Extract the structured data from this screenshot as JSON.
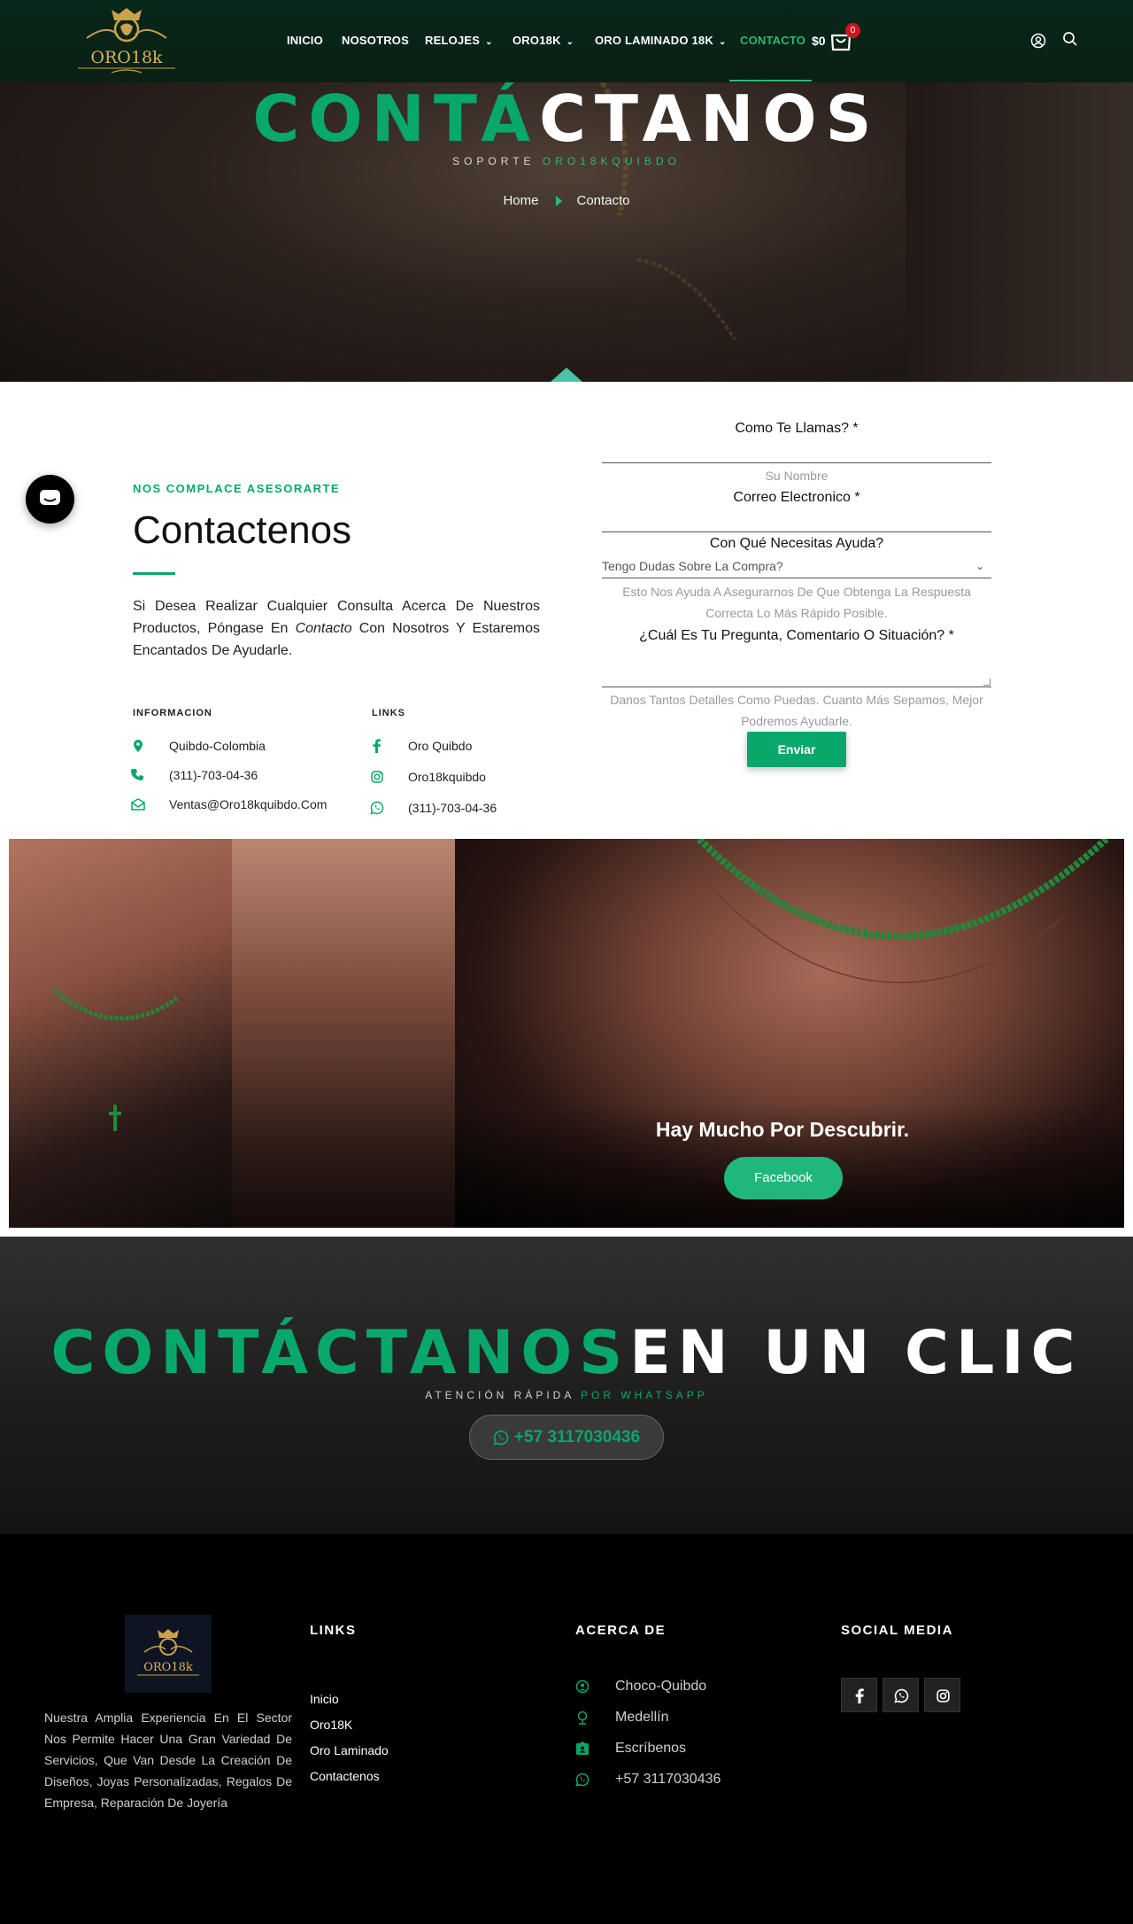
{
  "brand": {
    "logo_text": "ORO18k"
  },
  "nav": {
    "inicio": "INICIO",
    "nosotros": "NOSOTROS",
    "relojes": "RELOJES",
    "oro18k": "ORO18K",
    "oro_laminado": "ORO LAMINADO 18K",
    "contacto": "CONTACTO",
    "cart_amount": "$0",
    "cart_count": "0"
  },
  "hero": {
    "title_green": "CONTÁ",
    "title_white": "CTANOS",
    "sub_white": "SOPORTE ",
    "sub_green": "ORO18KQUIBDO",
    "breadcrumb_home": "Home",
    "breadcrumb_current": "Contacto"
  },
  "contact": {
    "eyebrow": "NOS COMPLACE ASESORARTE",
    "title": "Contactenos",
    "desc_pre": "Si Desea Realizar Cualquier Consulta Acerca De Nuestros Productos, Póngase En ",
    "desc_em": "Contacto",
    "desc_post": " Con Nosotros Y Estaremos Encantados De Ayudarle.",
    "info_heading": "INFORMACION",
    "links_heading": "LINKS",
    "info": [
      "Quibdo-Colombia",
      "(311)-703-04-36",
      "Ventas@Oro18kquibdo.Com"
    ],
    "links": [
      "Oro Quibdo",
      "Oro18kquibdo",
      "(311)-703-04-36"
    ]
  },
  "form": {
    "name_label": "Como Te Llamas? *",
    "name_hint": "Su Nombre",
    "email_label": "Correo Electronico *",
    "help_label": "Con Qué Necesitas Ayuda?",
    "help_selected": "Tengo Dudas Sobre La Compra?",
    "help_hint": "Esto Nos Ayuda A Asegurarnos De Que Obtenga La Respuesta Correcta Lo Más Rápido Posible.",
    "question_label": "¿Cuál Es Tu Pregunta, Comentario O Situación? *",
    "question_hint": "Danos Tantos Detalles Como Puedas. Cuanto Más Sepamos, Mejor Podremos Ayudarle.",
    "submit": "Enviar"
  },
  "banner": {
    "title": "Hay Mucho Por Descubrir.",
    "button": "Facebook"
  },
  "cta": {
    "title_green": "CONTÁCTANOS",
    "title_white": "EN UN CLIC",
    "sub_white": "ATENCIÓN RÁPIDA ",
    "sub_green": "POR WHATSAPP",
    "phone": "+57 3117030436"
  },
  "footer": {
    "about": "Nuestra Amplia Experiencia En El Sector Nos Permite Hacer Una Gran Variedad De Servicios, Que Van Desde La Creación De Diseños, Joyas Personalizadas, Regalos De Empresa, Reparación De Joyería",
    "links_heading": "LINKS",
    "links": [
      "Inicio",
      "Oro18K",
      "Oro Laminado",
      "Contactenos"
    ],
    "about_heading": "ACERCA DE",
    "about_items": [
      "Choco-Quibdo",
      "Medellín",
      "Escríbenos",
      "+57 3117030436"
    ],
    "social_heading": "SOCIAL MEDIA"
  },
  "icons": [
    "map-pin-icon",
    "phone-icon",
    "mail-icon",
    "facebook-icon",
    "instagram-icon",
    "whatsapp-icon",
    "cart-icon",
    "user-icon",
    "search-icon",
    "chat-icon",
    "location-icon",
    "id-card-icon"
  ],
  "colors": {
    "accent": "#08a86a",
    "header_bg": "#0b1f14",
    "footer_bg": "#000000",
    "badge": "#d2141e"
  }
}
